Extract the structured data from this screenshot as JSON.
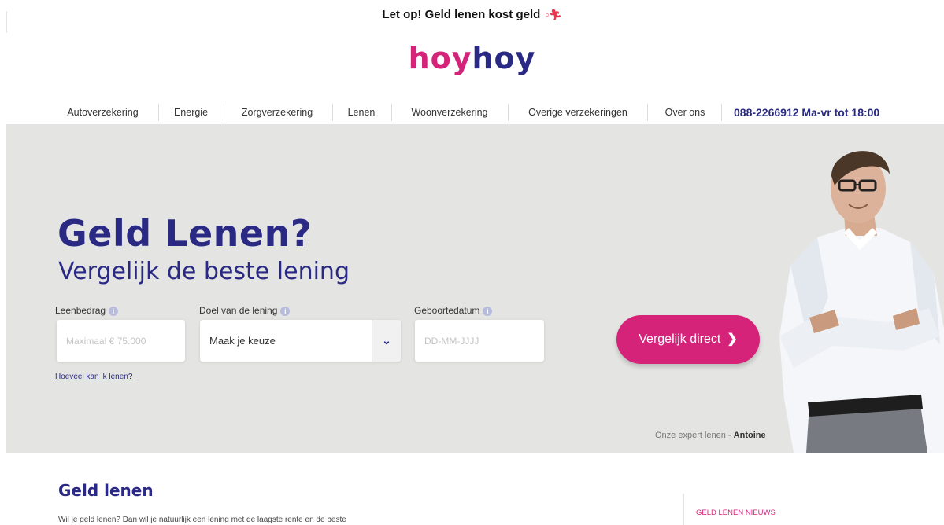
{
  "warning": {
    "text": "Let op! Geld lenen kost geld",
    "icon": "running-man-icon"
  },
  "logo": {
    "part1": "hoy",
    "part2": "hoy",
    "color1": "#d6237a",
    "color2": "#2a2a84"
  },
  "nav": {
    "items": [
      "Autoverzekering",
      "Energie",
      "Zorgverzekering",
      "Lenen",
      "Woonverzekering",
      "Overige verzekeringen",
      "Over ons"
    ],
    "phone": "088-2266912 Ma-vr tot 18:00"
  },
  "hero": {
    "title": "Geld Lenen?",
    "subtitle": "Vergelijk de beste lening",
    "fields": {
      "amount_label": "Leenbedrag",
      "amount_placeholder": "Maximaal € 75.000",
      "purpose_label": "Doel van de lening",
      "purpose_value": "Maak je keuze",
      "dob_label": "Geboortedatum",
      "dob_placeholder": "DD-MM-JJJJ",
      "info_glyph": "i"
    },
    "link": "Hoeveel kan ik lenen?",
    "cta": "Vergelijk direct",
    "cta_chevron": "❯",
    "caption_prefix": "Onze expert lenen - ",
    "caption_name": "Antoine"
  },
  "content": {
    "heading": "Geld lenen",
    "intro": "Wil je geld lenen? Dan wil je natuurlijk een lening met de laagste rente en de beste",
    "side_title": "GELD LENEN NIEUWS"
  },
  "colors": {
    "brand_pink": "#d6237a",
    "brand_navy": "#2a2a84",
    "hero_bg": "#e4e4e2"
  }
}
